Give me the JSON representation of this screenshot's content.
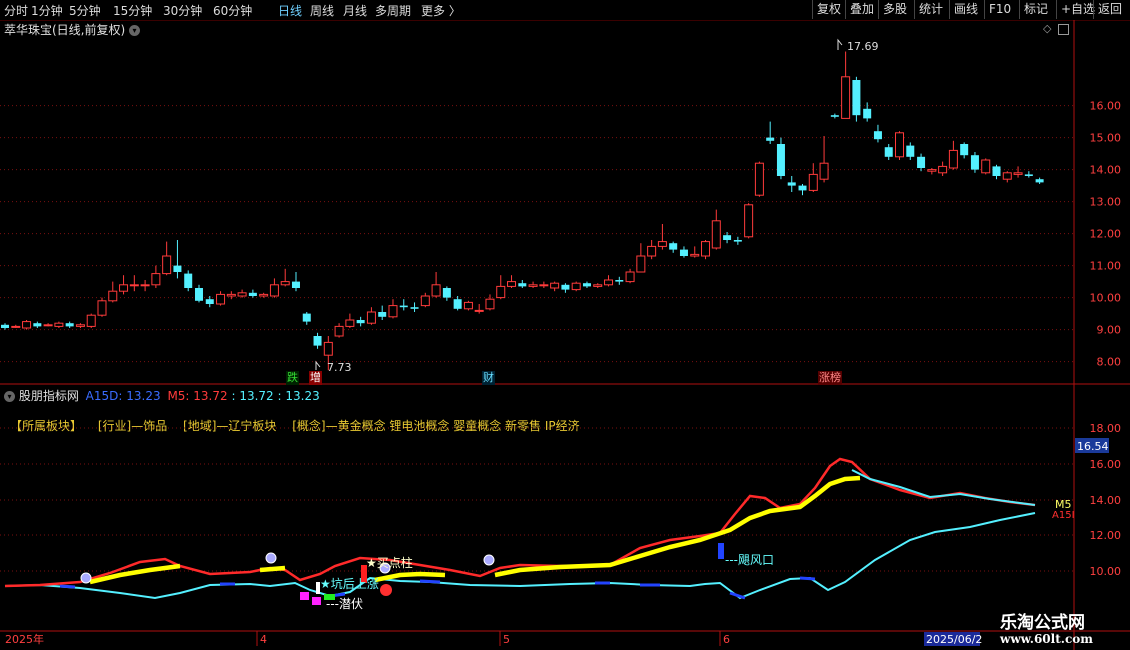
{
  "toolbar": {
    "periods": [
      {
        "label": "分时",
        "active": false
      },
      {
        "label": "1分钟",
        "active": false
      },
      {
        "label": "5分钟",
        "active": false
      },
      {
        "label": "15分钟",
        "active": false
      },
      {
        "label": "30分钟",
        "active": false
      },
      {
        "label": "60分钟",
        "active": false
      },
      {
        "label": "日线",
        "active": true
      },
      {
        "label": "周线",
        "active": false
      },
      {
        "label": "月线",
        "active": false
      },
      {
        "label": "多周期",
        "active": false
      },
      {
        "label": "更多 〉",
        "active": false
      }
    ],
    "buttons": [
      "复权",
      "叠加",
      "多股",
      "统计",
      "画线",
      "F10",
      "标记",
      "+自选",
      "返回"
    ]
  },
  "main_panel": {
    "title": "萃华珠宝(日线,前复权)",
    "high_label": "17.69",
    "low_label": "7.73",
    "y_ticks": [
      "16.00",
      "15.00",
      "14.00",
      "13.00",
      "12.00",
      "11.00",
      "10.00",
      "9.00",
      "8.00"
    ],
    "events": [
      {
        "label": "跌",
        "color": "#33dd33",
        "bg": "#002200"
      },
      {
        "label": "增",
        "color": "#ffffff",
        "bg": "#880000"
      },
      {
        "label": "财",
        "color": "#66ddff",
        "bg": "#002233"
      },
      {
        "label": "涨榜",
        "color": "#ff8888",
        "bg": "#550000"
      }
    ]
  },
  "indicator_panel": {
    "name": "股朋指标网",
    "a15d_label": "A15D: 13.23",
    "m5_label": "M5: 13.72",
    "v3_label": ": 13.72",
    "v4_label": ": 13.23",
    "sectors": [
      "【所属板块】",
      "[行业]—饰品",
      "[地域]—辽宁板块",
      "[概念]—黄金概念 锂电池概念 婴童概念 新零售 IP经济"
    ],
    "price_tag": "16.54",
    "y_ticks": [
      "18.00",
      "16.00",
      "14.00",
      "12.00",
      "10.00"
    ],
    "annotations": {
      "buy": "买点柱",
      "pit": "坑后上涨",
      "hidden": "---潜伏",
      "tuyere": "---飓风口"
    },
    "m5_end": "M5",
    "a15_end": "A15I"
  },
  "date_axis": {
    "labels": [
      "2025年",
      "4",
      "5",
      "6"
    ],
    "current_date": "2025/06/2"
  },
  "watermark": {
    "line1": "乐淘公式网",
    "line2": "www.60lt.com"
  },
  "colors": {
    "up": "#ff3b3b",
    "down": "#54f0ff",
    "grid": "#7a1010",
    "axis": "#b01010",
    "label": "#ff4040"
  },
  "chart_data": {
    "type": "candlestick",
    "title": "萃华珠宝(日线,前复权)",
    "ylim": [
      7.3,
      18.3
    ],
    "y_ticks": [
      8,
      9,
      10,
      11,
      12,
      13,
      14,
      15,
      16
    ],
    "candles": [
      {
        "o": 9.15,
        "c": 9.05,
        "h": 9.2,
        "l": 9.0
      },
      {
        "o": 9.1,
        "c": 9.1,
        "h": 9.15,
        "l": 9.05
      },
      {
        "o": 9.05,
        "c": 9.25,
        "h": 9.3,
        "l": 9.0
      },
      {
        "o": 9.2,
        "c": 9.1,
        "h": 9.25,
        "l": 9.05
      },
      {
        "o": 9.15,
        "c": 9.15,
        "h": 9.2,
        "l": 9.1
      },
      {
        "o": 9.1,
        "c": 9.2,
        "h": 9.25,
        "l": 9.05
      },
      {
        "o": 9.2,
        "c": 9.1,
        "h": 9.25,
        "l": 9.05
      },
      {
        "o": 9.1,
        "c": 9.15,
        "h": 9.2,
        "l": 9.05
      },
      {
        "o": 9.1,
        "c": 9.45,
        "h": 9.5,
        "l": 9.05
      },
      {
        "o": 9.45,
        "c": 9.9,
        "h": 10.0,
        "l": 9.4
      },
      {
        "o": 9.9,
        "c": 10.2,
        "h": 10.5,
        "l": 9.85
      },
      {
        "o": 10.2,
        "c": 10.4,
        "h": 10.7,
        "l": 10.1
      },
      {
        "o": 10.4,
        "c": 10.4,
        "h": 10.7,
        "l": 10.2
      },
      {
        "o": 10.4,
        "c": 10.4,
        "h": 10.55,
        "l": 10.2
      },
      {
        "o": 10.4,
        "c": 10.75,
        "h": 11.0,
        "l": 10.3
      },
      {
        "o": 10.75,
        "c": 11.3,
        "h": 11.75,
        "l": 10.7
      },
      {
        "o": 11.0,
        "c": 10.8,
        "h": 11.8,
        "l": 10.6
      },
      {
        "o": 10.75,
        "c": 10.3,
        "h": 10.85,
        "l": 10.2
      },
      {
        "o": 10.3,
        "c": 9.9,
        "h": 10.4,
        "l": 9.85
      },
      {
        "o": 9.95,
        "c": 9.8,
        "h": 10.05,
        "l": 9.7
      },
      {
        "o": 9.8,
        "c": 10.1,
        "h": 10.2,
        "l": 9.75
      },
      {
        "o": 10.05,
        "c": 10.1,
        "h": 10.2,
        "l": 9.95
      },
      {
        "o": 10.05,
        "c": 10.15,
        "h": 10.25,
        "l": 10.0
      },
      {
        "o": 10.15,
        "c": 10.05,
        "h": 10.25,
        "l": 10.0
      },
      {
        "o": 10.05,
        "c": 10.1,
        "h": 10.15,
        "l": 10.0
      },
      {
        "o": 10.05,
        "c": 10.4,
        "h": 10.6,
        "l": 10.0
      },
      {
        "o": 10.4,
        "c": 10.5,
        "h": 10.9,
        "l": 10.35
      },
      {
        "o": 10.5,
        "c": 10.3,
        "h": 10.8,
        "l": 10.2
      },
      {
        "o": 9.5,
        "c": 9.25,
        "h": 9.55,
        "l": 9.15
      },
      {
        "o": 8.8,
        "c": 8.5,
        "h": 8.9,
        "l": 8.4
      },
      {
        "o": 8.2,
        "c": 8.6,
        "h": 8.8,
        "l": 7.73
      },
      {
        "o": 8.8,
        "c": 9.1,
        "h": 9.2,
        "l": 8.75
      },
      {
        "o": 9.1,
        "c": 9.3,
        "h": 9.5,
        "l": 9.05
      },
      {
        "o": 9.3,
        "c": 9.2,
        "h": 9.4,
        "l": 9.1
      },
      {
        "o": 9.2,
        "c": 9.55,
        "h": 9.7,
        "l": 9.15
      },
      {
        "o": 9.55,
        "c": 9.4,
        "h": 9.75,
        "l": 9.3
      },
      {
        "o": 9.4,
        "c": 9.75,
        "h": 9.95,
        "l": 9.35
      },
      {
        "o": 9.75,
        "c": 9.7,
        "h": 9.95,
        "l": 9.6
      },
      {
        "o": 9.7,
        "c": 9.65,
        "h": 9.85,
        "l": 9.55
      },
      {
        "o": 9.75,
        "c": 10.05,
        "h": 10.15,
        "l": 9.7
      },
      {
        "o": 10.05,
        "c": 10.4,
        "h": 10.8,
        "l": 10.0
      },
      {
        "o": 10.3,
        "c": 10.0,
        "h": 10.35,
        "l": 9.9
      },
      {
        "o": 9.95,
        "c": 9.65,
        "h": 10.05,
        "l": 9.6
      },
      {
        "o": 9.65,
        "c": 9.85,
        "h": 9.9,
        "l": 9.6
      },
      {
        "o": 9.6,
        "c": 9.6,
        "h": 9.8,
        "l": 9.5
      },
      {
        "o": 9.65,
        "c": 9.95,
        "h": 10.1,
        "l": 9.6
      },
      {
        "o": 10.0,
        "c": 10.35,
        "h": 10.7,
        "l": 9.95
      },
      {
        "o": 10.35,
        "c": 10.5,
        "h": 10.7,
        "l": 10.3
      },
      {
        "o": 10.45,
        "c": 10.35,
        "h": 10.55,
        "l": 10.3
      },
      {
        "o": 10.35,
        "c": 10.4,
        "h": 10.5,
        "l": 10.3
      },
      {
        "o": 10.4,
        "c": 10.4,
        "h": 10.5,
        "l": 10.3
      },
      {
        "o": 10.3,
        "c": 10.45,
        "h": 10.5,
        "l": 10.2
      },
      {
        "o": 10.4,
        "c": 10.25,
        "h": 10.45,
        "l": 10.15
      },
      {
        "o": 10.25,
        "c": 10.45,
        "h": 10.5,
        "l": 10.2
      },
      {
        "o": 10.45,
        "c": 10.35,
        "h": 10.5,
        "l": 10.3
      },
      {
        "o": 10.35,
        "c": 10.4,
        "h": 10.45,
        "l": 10.3
      },
      {
        "o": 10.4,
        "c": 10.55,
        "h": 10.7,
        "l": 10.35
      },
      {
        "o": 10.55,
        "c": 10.5,
        "h": 10.65,
        "l": 10.4
      },
      {
        "o": 10.5,
        "c": 10.8,
        "h": 10.9,
        "l": 10.45
      },
      {
        "o": 10.8,
        "c": 11.3,
        "h": 11.7,
        "l": 10.8
      },
      {
        "o": 11.3,
        "c": 11.6,
        "h": 11.8,
        "l": 11.2
      },
      {
        "o": 11.6,
        "c": 11.75,
        "h": 12.3,
        "l": 11.5
      },
      {
        "o": 11.7,
        "c": 11.5,
        "h": 11.75,
        "l": 11.4
      },
      {
        "o": 11.5,
        "c": 11.3,
        "h": 11.6,
        "l": 11.25
      },
      {
        "o": 11.3,
        "c": 11.35,
        "h": 11.6,
        "l": 11.25
      },
      {
        "o": 11.3,
        "c": 11.75,
        "h": 11.8,
        "l": 11.2
      },
      {
        "o": 11.55,
        "c": 12.4,
        "h": 12.75,
        "l": 11.5
      },
      {
        "o": 11.95,
        "c": 11.8,
        "h": 12.05,
        "l": 11.7
      },
      {
        "o": 11.8,
        "c": 11.75,
        "h": 11.9,
        "l": 11.65
      },
      {
        "o": 11.9,
        "c": 12.9,
        "h": 12.95,
        "l": 11.85
      },
      {
        "o": 13.2,
        "c": 14.2,
        "h": 14.25,
        "l": 13.15
      },
      {
        "o": 15.0,
        "c": 14.9,
        "h": 15.5,
        "l": 14.8
      },
      {
        "o": 14.8,
        "c": 13.8,
        "h": 15.0,
        "l": 13.7
      },
      {
        "o": 13.6,
        "c": 13.5,
        "h": 13.8,
        "l": 13.3
      },
      {
        "o": 13.5,
        "c": 13.35,
        "h": 13.55,
        "l": 13.2
      },
      {
        "o": 13.35,
        "c": 13.85,
        "h": 14.2,
        "l": 13.3
      },
      {
        "o": 13.7,
        "c": 14.2,
        "h": 15.05,
        "l": 13.6
      },
      {
        "o": 15.7,
        "c": 15.65,
        "h": 15.75,
        "l": 15.6
      },
      {
        "o": 15.6,
        "c": 16.9,
        "h": 17.69,
        "l": 15.6
      },
      {
        "o": 16.8,
        "c": 15.7,
        "h": 16.9,
        "l": 15.5
      },
      {
        "o": 15.9,
        "c": 15.6,
        "h": 16.1,
        "l": 15.5
      },
      {
        "o": 15.2,
        "c": 14.95,
        "h": 15.4,
        "l": 14.85
      },
      {
        "o": 14.7,
        "c": 14.4,
        "h": 14.8,
        "l": 14.3
      },
      {
        "o": 14.4,
        "c": 15.15,
        "h": 15.2,
        "l": 14.3
      },
      {
        "o": 14.75,
        "c": 14.4,
        "h": 14.85,
        "l": 14.3
      },
      {
        "o": 14.4,
        "c": 14.05,
        "h": 14.5,
        "l": 13.95
      },
      {
        "o": 13.95,
        "c": 14.0,
        "h": 14.05,
        "l": 13.85
      },
      {
        "o": 13.9,
        "c": 14.1,
        "h": 14.25,
        "l": 13.8
      },
      {
        "o": 14.05,
        "c": 14.6,
        "h": 14.9,
        "l": 14.0
      },
      {
        "o": 14.8,
        "c": 14.45,
        "h": 14.85,
        "l": 14.35
      },
      {
        "o": 14.45,
        "c": 14.0,
        "h": 14.55,
        "l": 13.9
      },
      {
        "o": 13.9,
        "c": 14.3,
        "h": 14.35,
        "l": 13.85
      },
      {
        "o": 14.1,
        "c": 13.8,
        "h": 14.15,
        "l": 13.7
      },
      {
        "o": 13.7,
        "c": 13.9,
        "h": 13.95,
        "l": 13.6
      },
      {
        "o": 13.85,
        "c": 13.9,
        "h": 14.1,
        "l": 13.75
      },
      {
        "o": 13.85,
        "c": 13.8,
        "h": 13.95,
        "l": 13.75
      },
      {
        "o": 13.7,
        "c": 13.6,
        "h": 13.75,
        "l": 13.55
      }
    ]
  }
}
